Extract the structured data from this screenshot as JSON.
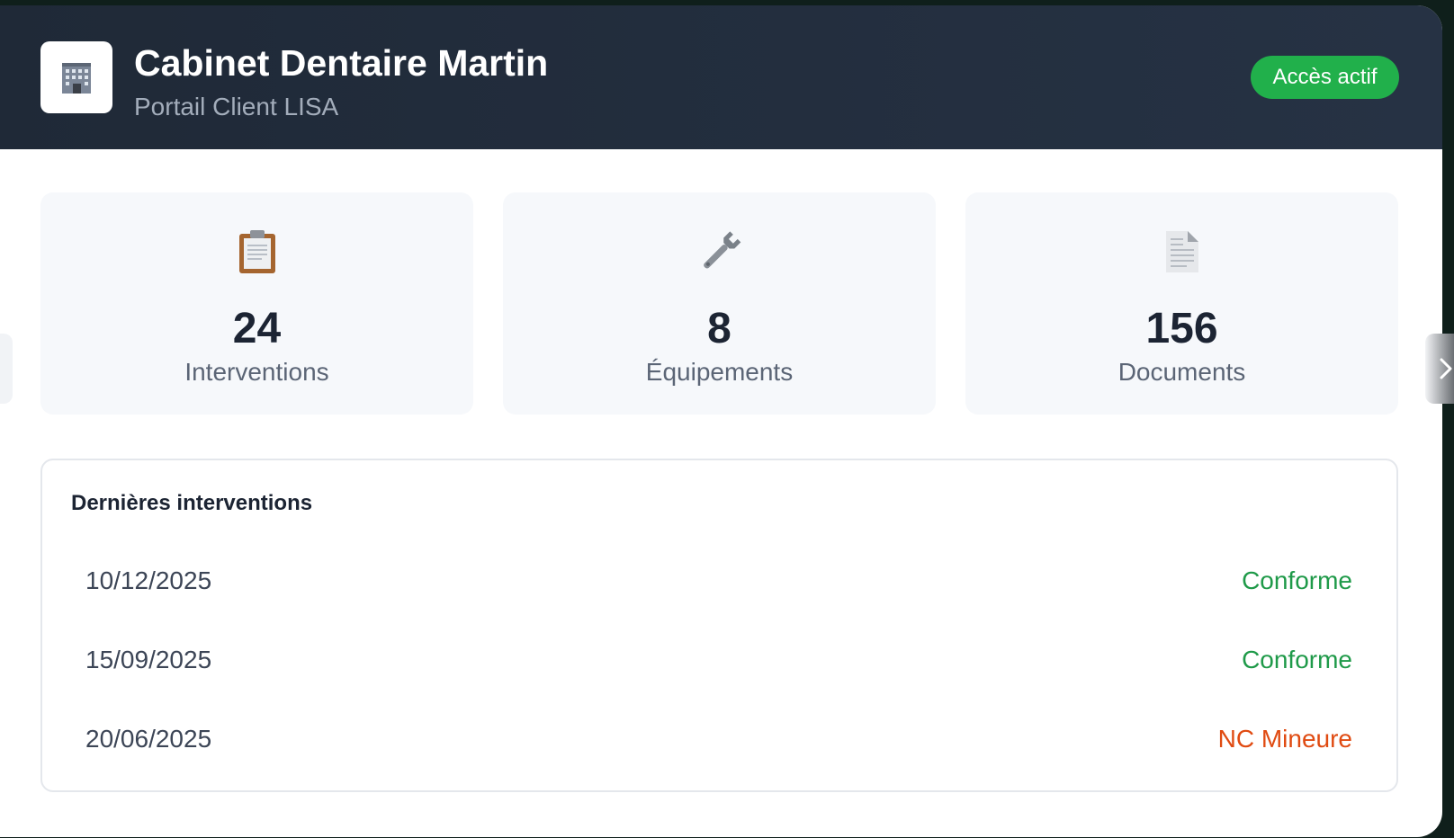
{
  "header": {
    "title": "Cabinet Dentaire Martin",
    "subtitle": "Portail Client LISA",
    "status_badge": "Accès actif",
    "logo_icon": "office-building-icon"
  },
  "stats": [
    {
      "icon": "clipboard-icon",
      "value": "24",
      "label": "Interventions"
    },
    {
      "icon": "wrench-icon",
      "value": "8",
      "label": "Équipements"
    },
    {
      "icon": "document-icon",
      "value": "156",
      "label": "Documents"
    }
  ],
  "recent": {
    "title": "Dernières interventions",
    "rows": [
      {
        "date": "10/12/2025",
        "status": "Conforme"
      },
      {
        "date": "15/09/2025",
        "status": "Conforme"
      },
      {
        "date": "20/06/2025",
        "status": "NC Mineure"
      }
    ]
  },
  "colors": {
    "header_bg": "#1f2937",
    "badge": "#21b04b",
    "status_ok": "#1f9a49",
    "status_warn": "#e04b12"
  }
}
